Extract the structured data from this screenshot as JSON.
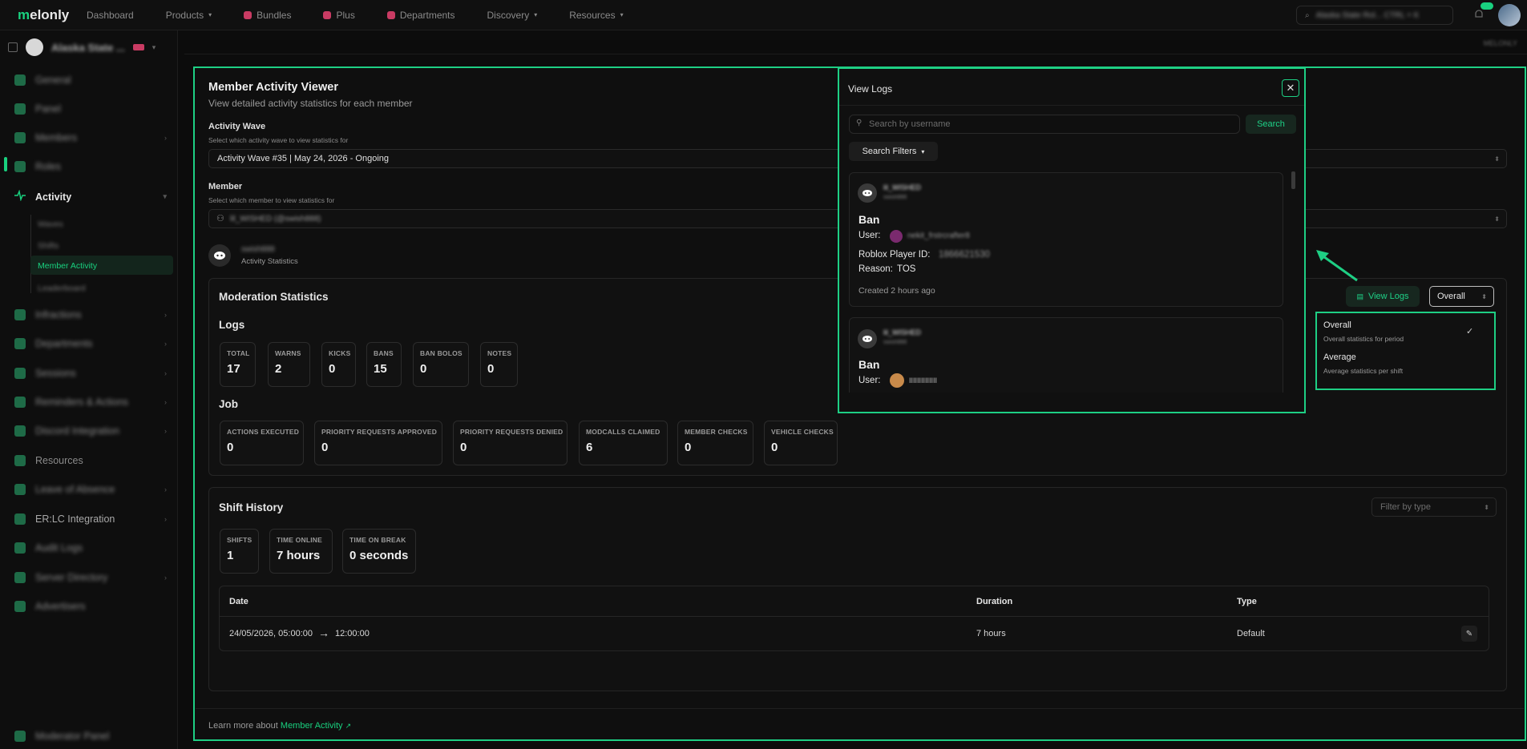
{
  "topbar": {
    "logo_prefix": "m",
    "logo_rest": "elonly",
    "nav": [
      "Dashboard",
      "Products",
      "Bundles",
      "Plus",
      "Departments",
      "Discovery",
      "Resources"
    ],
    "search_text": "Alaska State Rol...  CTRL + K"
  },
  "sidebar": {
    "server_name": "Alaska State ...",
    "items": [
      "General",
      "Panel",
      "Members",
      "Roles",
      "Activity",
      "Infractions",
      "Departments",
      "Sessions",
      "Reminders & Actions",
      "Discord Integration",
      "Resources",
      "Leave of Absence",
      "ER:LC Integration",
      "Audit Logs",
      "Server Directory",
      "Advertisers"
    ],
    "activity_sub": [
      "Waves",
      "Shifts",
      "Member Activity",
      "Leaderboard"
    ],
    "bottom": "Moderator Panel"
  },
  "strip_right": "MELONLY",
  "viewer": {
    "title": "Member Activity Viewer",
    "subtitle": "View detailed activity statistics for each member",
    "wave_label": "Activity Wave",
    "wave_hint": "Select which activity wave to view statistics for",
    "wave_value": "Activity Wave #35 | May 24, 2026 - Ongoing",
    "member_label": "Member",
    "member_hint": "Select which member to view statistics for",
    "member_value": "lil_WISHED (@swish888)",
    "user_name": "swish888",
    "user_caption": "Activity Statistics"
  },
  "moderation": {
    "title": "Moderation Statistics",
    "logs_title": "Logs",
    "logs": [
      {
        "k": "TOTAL",
        "v": "17"
      },
      {
        "k": "WARNS",
        "v": "2"
      },
      {
        "k": "KICKS",
        "v": "0"
      },
      {
        "k": "BANS",
        "v": "15"
      },
      {
        "k": "BAN BOLOS",
        "v": "0"
      },
      {
        "k": "NOTES",
        "v": "0"
      }
    ],
    "job_title": "Job",
    "job": [
      {
        "k": "ACTIONS EXECUTED",
        "v": "0"
      },
      {
        "k": "PRIORITY REQUESTS APPROVED",
        "v": "0"
      },
      {
        "k": "PRIORITY REQUESTS DENIED",
        "v": "0"
      },
      {
        "k": "MODCALLS CLAIMED",
        "v": "6"
      },
      {
        "k": "MEMBER CHECKS",
        "v": "0"
      },
      {
        "k": "VEHICLE CHECKS",
        "v": "0"
      }
    ],
    "view_logs": "View Logs",
    "period_select": "Overall",
    "period_options": [
      {
        "label": "Overall",
        "desc": "Overall statistics for period"
      },
      {
        "label": "Average",
        "desc": "Average statistics per shift"
      }
    ]
  },
  "shifts": {
    "title": "Shift History",
    "filter_placeholder": "Filter by type",
    "stats": [
      {
        "k": "SHIFTS",
        "v": "1"
      },
      {
        "k": "TIME ONLINE",
        "v": "7 hours"
      },
      {
        "k": "TIME ON BREAK",
        "v": "0 seconds"
      }
    ],
    "columns": [
      "Date",
      "Duration",
      "Type"
    ],
    "rows": [
      {
        "start": "24/05/2026, 05:00:00",
        "end": "12:00:00",
        "duration": "7 hours",
        "type": "Default"
      }
    ]
  },
  "footer": {
    "text": "Learn more about",
    "link": "Member Activity"
  },
  "modal": {
    "title": "View Logs",
    "search_placeholder": "Search by username",
    "search_button": "Search",
    "filters_button": "Search Filters",
    "logs": [
      {
        "mod_name": "lil_WISHED",
        "mod_id": "swish888",
        "action": "Ban",
        "user_label": "User:",
        "user": "nekit_frstrcrafter8",
        "roblox_label": "Roblox Player ID:",
        "roblox_id": "1866621530",
        "reason_label": "Reason:",
        "reason": "TOS",
        "created": "Created 2 hours ago"
      },
      {
        "mod_name": "lil_WISHED",
        "mod_id": "swish888",
        "action": "Ban",
        "user_label": "User:",
        "user": "IIIIIIIIIIIIII"
      }
    ]
  },
  "colors": {
    "accent": "#1ecf84",
    "bg": "#0c0c0c"
  }
}
